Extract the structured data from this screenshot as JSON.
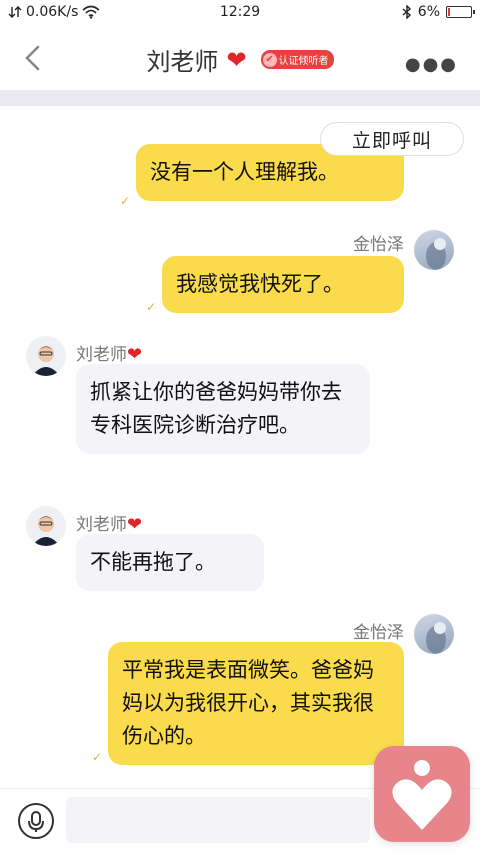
{
  "status_bar": {
    "network_speed": "0.06K/s",
    "time": "12:29",
    "battery": "6%"
  },
  "header": {
    "title": "刘老师",
    "title_icon": "heart-icon",
    "badge": "认证倾听者",
    "back_icon": "chevron-left-icon",
    "more_icon": "more-icon"
  },
  "call_button": {
    "label": "立即呼叫"
  },
  "messages": [
    {
      "sender": "me",
      "name": "",
      "text": "没有一个人理解我。"
    },
    {
      "sender": "me",
      "name": "金怡泽",
      "text": "我感觉我快死了。"
    },
    {
      "sender": "teacher",
      "name": "刘老师",
      "text": "抓紧让你的爸爸妈妈带你去专科医院诊断治疗吧。"
    },
    {
      "sender": "teacher",
      "name": "刘老师",
      "text": "不能再拖了。"
    },
    {
      "sender": "me",
      "name": "金怡泽",
      "text": "平常我是表面微笑。爸爸妈妈以为我很开心，其实我很伤心的。"
    }
  ],
  "input": {
    "placeholder": "",
    "mic_icon": "microphone-icon"
  },
  "float_button": {
    "icon": "heart-person-icon"
  },
  "colors": {
    "bubble_mine": "#fadb4c",
    "bubble_theirs": "#f3f3f8",
    "badge": "#e8413f",
    "float_button": "#e7858a"
  }
}
